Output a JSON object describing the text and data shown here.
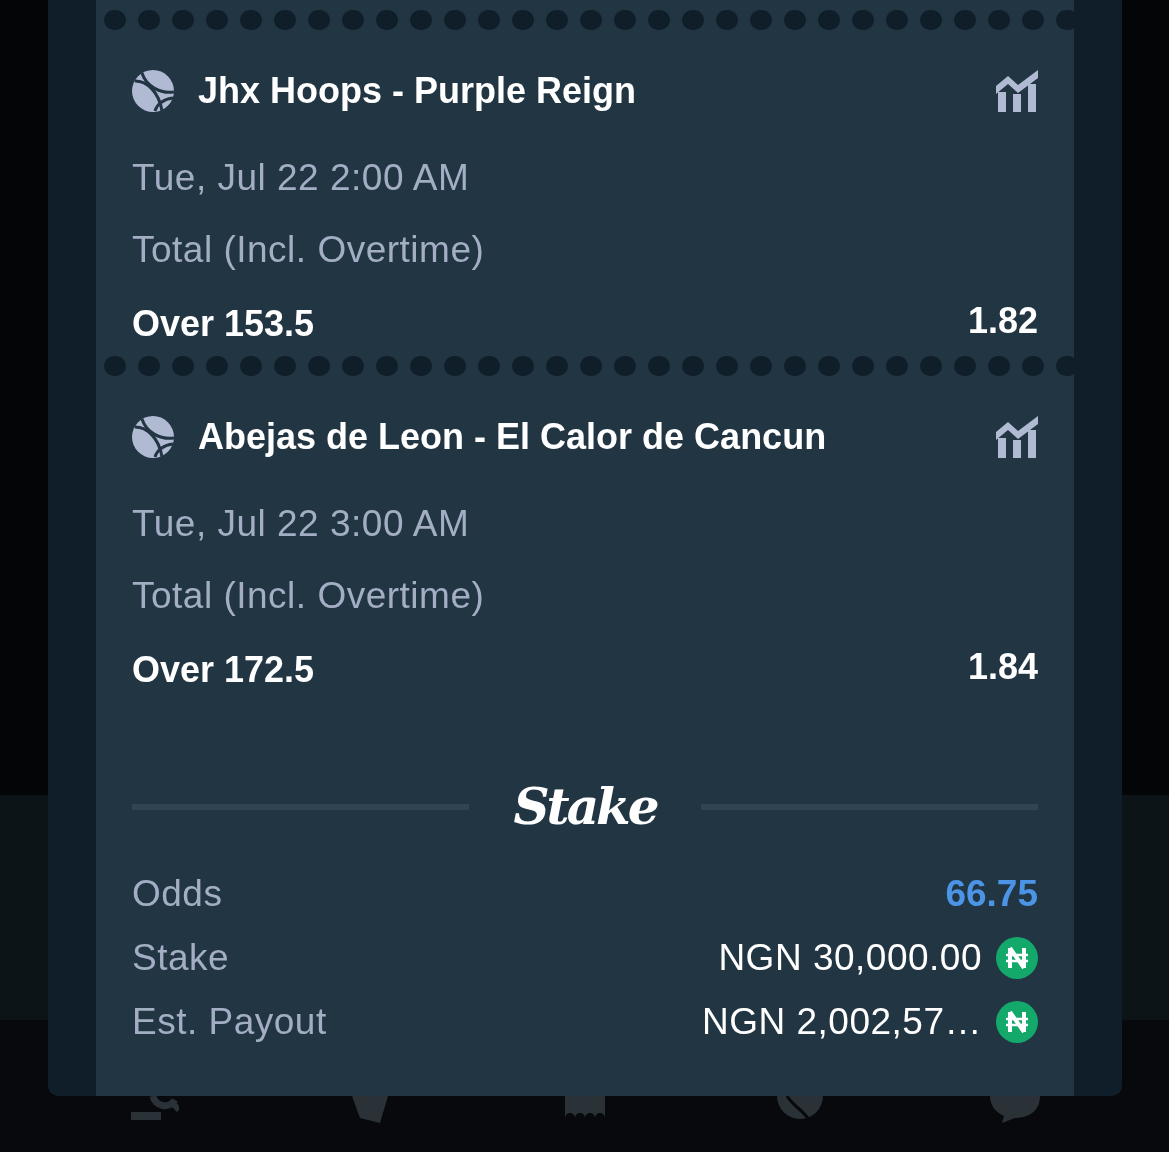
{
  "bets": [
    {
      "event": "Jhx Hoops - Purple Reign",
      "start_time": "Tue, Jul 22 2:00 AM",
      "market": "Total (Incl. Overtime)",
      "selection": "Over 153.5",
      "odds": "1.82"
    },
    {
      "event": "Abejas de Leon - El Calor de Cancun",
      "start_time": "Tue, Jul 22 3:00 AM",
      "market": "Total (Incl. Overtime)",
      "selection": "Over 172.5",
      "odds": "1.84"
    }
  ],
  "brand": {
    "logo": "Stake"
  },
  "summary": [
    {
      "kind": "odds",
      "label": "Odds",
      "value": "66.75"
    },
    {
      "kind": "amount",
      "label": "Stake",
      "value": "NGN 30,000.00"
    },
    {
      "kind": "amount",
      "label": "Est. Payout",
      "value": "NGN 2,002,57…"
    }
  ]
}
